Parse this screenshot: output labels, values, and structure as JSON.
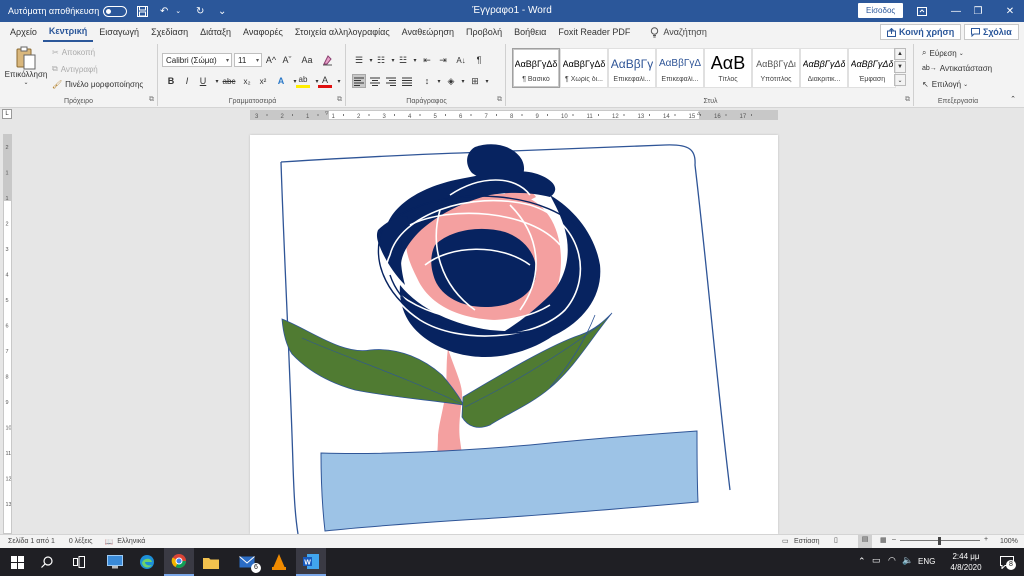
{
  "titlebar": {
    "autosave_label": "Αυτόματη αποθήκευση",
    "autosave_state": "off",
    "doc_title": "Έγγραφο1  -  Word",
    "signin_label": "Είσοδος",
    "minimize_glyph": "—",
    "restore_glyph": "❐",
    "close_glyph": "✕"
  },
  "tabs": [
    {
      "label": "Αρχείο",
      "active": false
    },
    {
      "label": "Κεντρική",
      "active": true
    },
    {
      "label": "Εισαγωγή",
      "active": false
    },
    {
      "label": "Σχεδίαση",
      "active": false
    },
    {
      "label": "Διάταξη",
      "active": false
    },
    {
      "label": "Αναφορές",
      "active": false
    },
    {
      "label": "Στοιχεία αλληλογραφίας",
      "active": false
    },
    {
      "label": "Αναθεώρηση",
      "active": false
    },
    {
      "label": "Προβολή",
      "active": false
    },
    {
      "label": "Βοήθεια",
      "active": false
    },
    {
      "label": "Foxit Reader PDF",
      "active": false
    }
  ],
  "tell_me": "Αναζήτηση",
  "share_label": "Κοινή χρήση",
  "comments_label": "Σχόλια",
  "ribbon": {
    "clipboard": {
      "paste_label": "Επικόλληση",
      "cut_label": "Αποκοπή",
      "copy_label": "Αντιγραφή",
      "format_painter_label": "Πινέλο μορφοποίησης",
      "group_label": "Πρόχειρο"
    },
    "font": {
      "font_name": "Calibri (Σώμα)",
      "font_size": "11",
      "grow_label": "A^",
      "shrink_label": "Aˇ",
      "case_label": "Aa",
      "bold": "B",
      "italic": "I",
      "underline": "U",
      "strike": "abc",
      "subscript": "x₂",
      "superscript": "x²",
      "effects": "A",
      "highlight": "ab",
      "color": "A",
      "group_label": "Γραμματοσειρά"
    },
    "paragraph": {
      "group_label": "Παράγραφος",
      "pilcrow": "¶"
    },
    "styles": {
      "group_label": "Στυλ",
      "items": [
        {
          "sample": "ΑαΒβΓγΔδ",
          "name": "¶ Βασικό",
          "selected": true
        },
        {
          "sample": "ΑαΒβΓγΔδ",
          "name": "¶ Χωρίς δι...",
          "selected": false
        },
        {
          "sample": "ΑαΒβΓγ",
          "name": "Επικεφαλί...",
          "selected": false
        },
        {
          "sample": "ΑαΒβΓγΔ",
          "name": "Επικεφαλί...",
          "selected": false
        },
        {
          "sample": "ΑαΒ",
          "name": "Τίτλος",
          "selected": false
        },
        {
          "sample": "ΑαΒβΓγΔι",
          "name": "Υπότιτλος",
          "selected": false
        },
        {
          "sample": "ΑαΒβΓγΔδ",
          "name": "Διακριτικ...",
          "selected": false
        },
        {
          "sample": "ΑαΒβΓγΔδ",
          "name": "Έμφαση",
          "selected": false
        }
      ]
    },
    "editing": {
      "find_label": "Εύρεση",
      "replace_label": "Αντικατάσταση",
      "select_label": "Επιλογή",
      "group_label": "Επεξεργασία"
    }
  },
  "hruler_labels": [
    "3",
    "2",
    "1",
    "1",
    "2",
    "3",
    "4",
    "5",
    "6",
    "7",
    "8",
    "9",
    "10",
    "11",
    "12",
    "13",
    "14",
    "15",
    "16",
    "17"
  ],
  "vruler_labels": [
    "2",
    "1",
    "1",
    "2",
    "3",
    "4",
    "5",
    "6",
    "7",
    "8",
    "9",
    "10",
    "11",
    "12",
    "13"
  ],
  "statusbar": {
    "page": "Σελίδα 1 από 1",
    "words": "0 λέξεις",
    "language": "Ελληνικά",
    "focus": "Εστίαση",
    "zoom": "100%"
  },
  "taskbar": {
    "lang": "ENG",
    "time": "2:44 μμ",
    "date": "4/8/2020",
    "mail_badge": "6",
    "notif_badge": "8"
  },
  "colors": {
    "word_blue": "#2b579a",
    "rose_dark": "#072360",
    "rose_pink": "#f4a0a0",
    "leaf_green": "#507b32",
    "vase_blue": "#9dc3e6",
    "outline": "#2f5597"
  }
}
